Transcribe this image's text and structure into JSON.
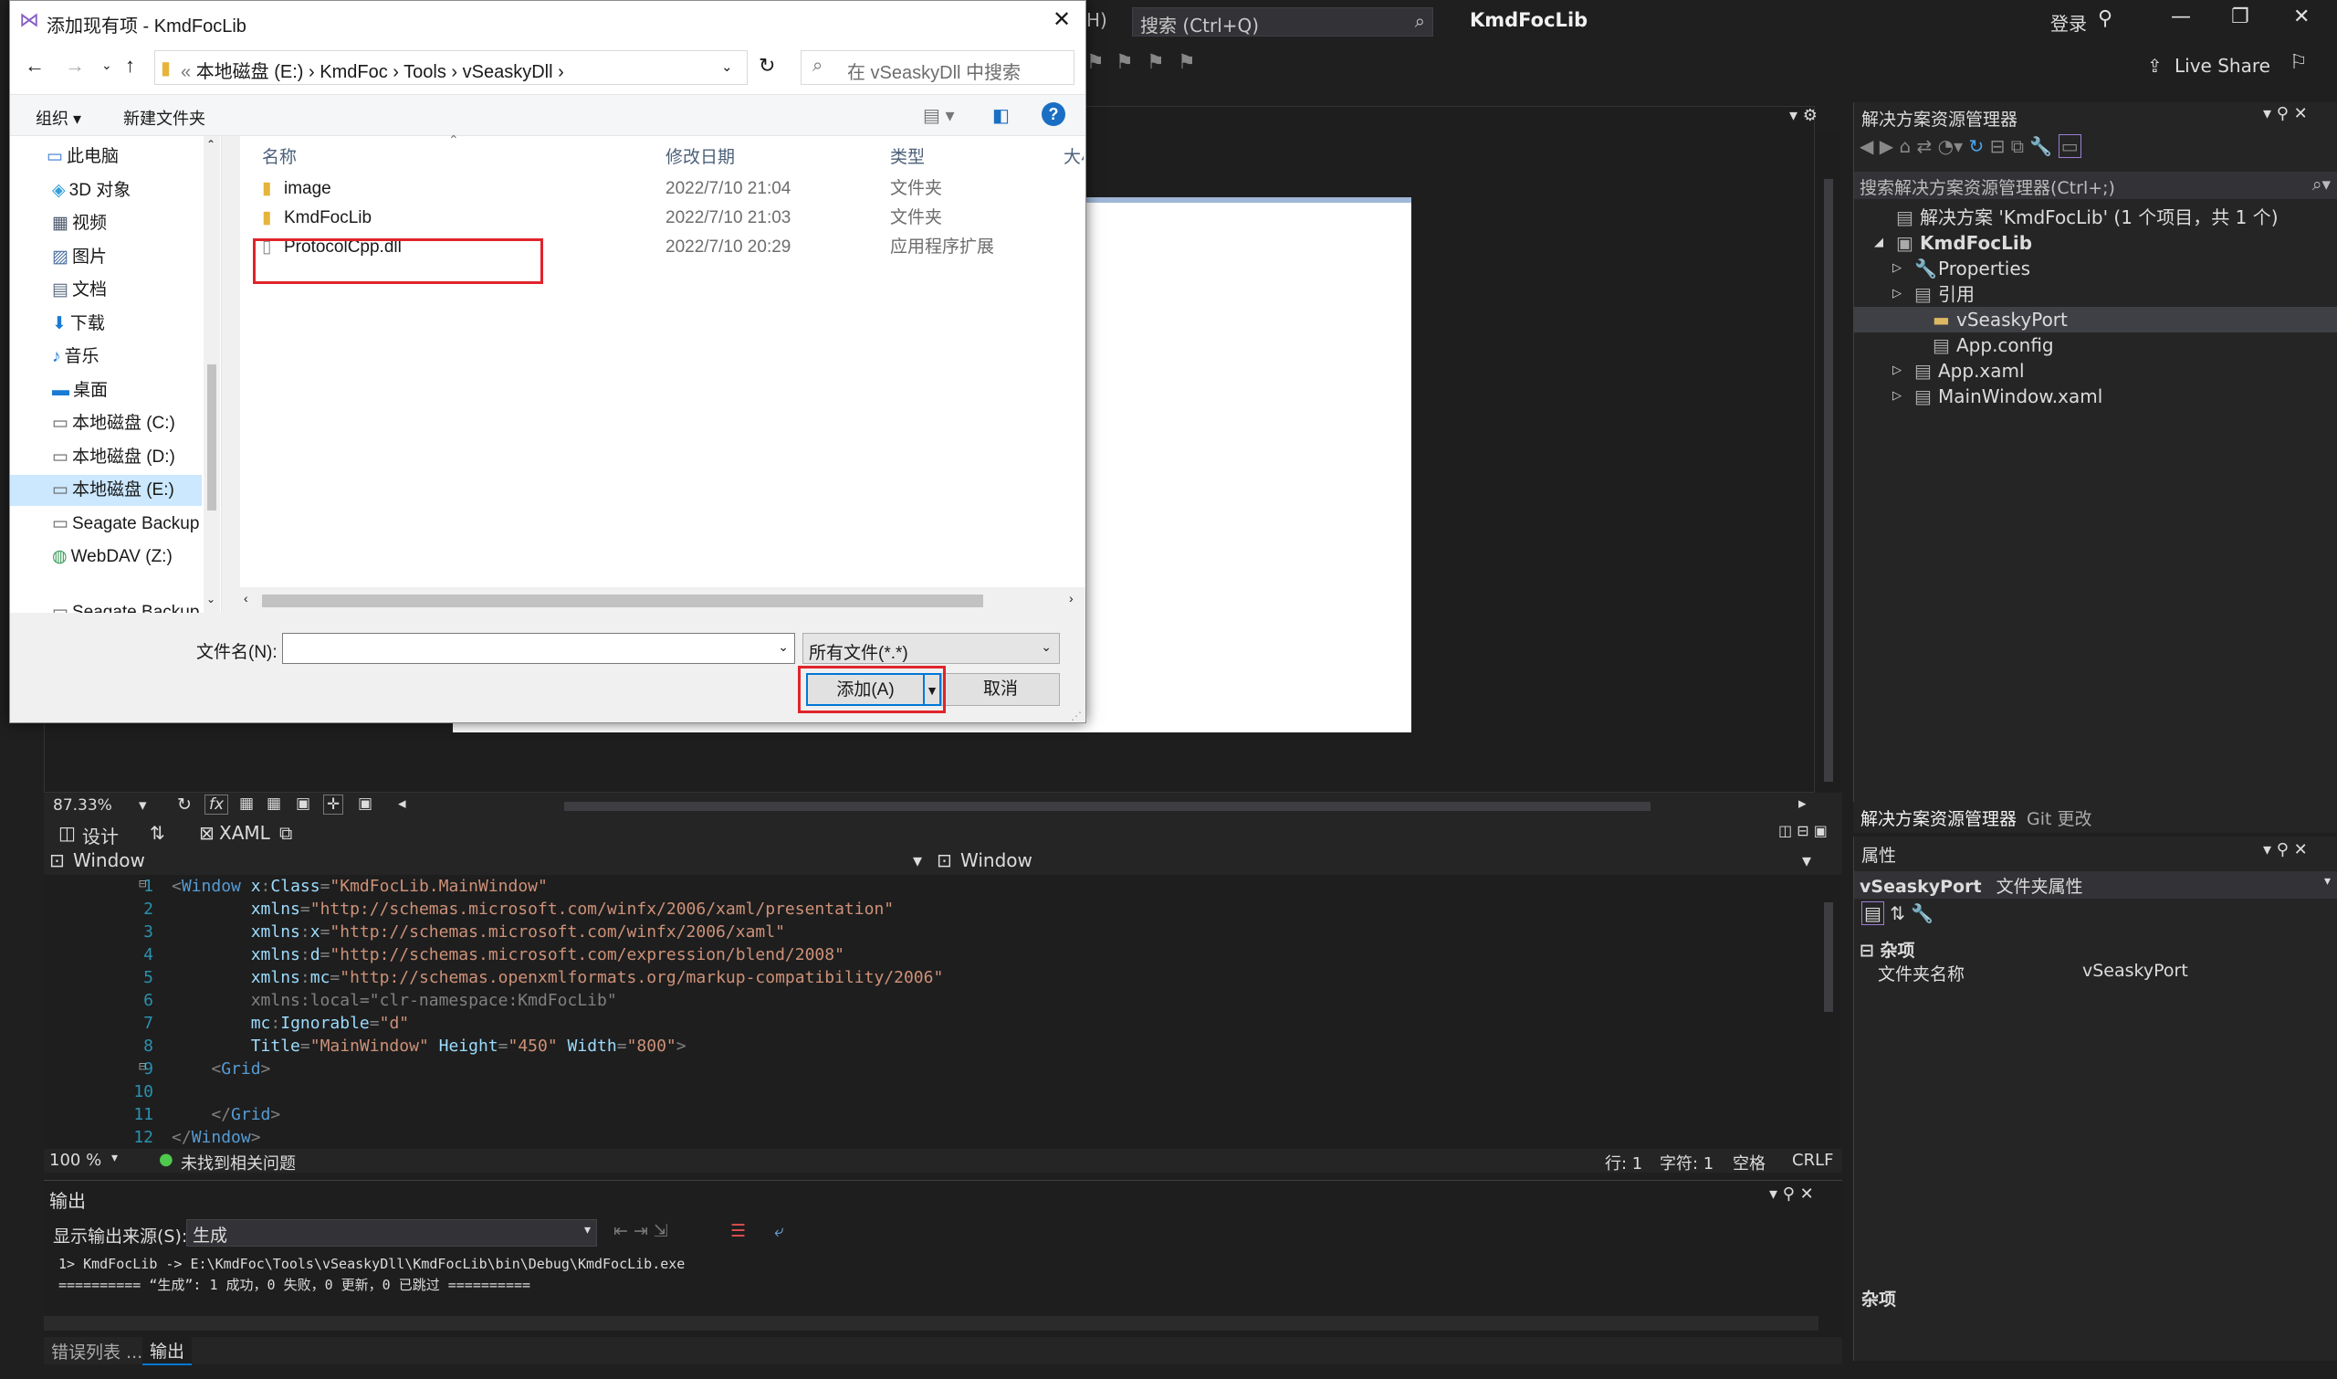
{
  "vs": {
    "menu_fragment": "H)",
    "search_placeholder": "搜索 (Ctrl+Q)",
    "app_title": "KmdFocLib",
    "login": "登录",
    "live_share": "Live Share"
  },
  "designer": {
    "zoom": "87.33%",
    "tab_design": "设计",
    "tab_swap": "⇅",
    "tab_xaml": "XAML"
  },
  "xaml": {
    "left_scope": "Window",
    "right_scope": "Window",
    "zoom": "100 %",
    "issues": "未找到相关问题",
    "row": "行: 1",
    "col": "字符: 1",
    "spaces": "空格",
    "eol": "CRLF",
    "lines": [
      {
        "n": "1",
        "parts": [
          [
            "gray",
            "<"
          ],
          [
            "tag",
            "Window "
          ],
          [
            "attr",
            "x"
          ],
          [
            "gray",
            ":"
          ],
          [
            "attr",
            "Class"
          ],
          [
            "gray",
            "="
          ],
          [
            "val",
            "\"KmdFocLib.MainWindow\""
          ]
        ]
      },
      {
        "n": "2",
        "parts": [
          [
            "gray",
            "        "
          ],
          [
            "attr",
            "xmlns"
          ],
          [
            "gray",
            "="
          ],
          [
            "val",
            "\"http://schemas.microsoft.com/winfx/2006/xaml/presentation\""
          ]
        ]
      },
      {
        "n": "3",
        "parts": [
          [
            "gray",
            "        "
          ],
          [
            "attr",
            "xmlns"
          ],
          [
            "gray",
            ":"
          ],
          [
            "attr",
            "x"
          ],
          [
            "gray",
            "="
          ],
          [
            "val",
            "\"http://schemas.microsoft.com/winfx/2006/xaml\""
          ]
        ]
      },
      {
        "n": "4",
        "parts": [
          [
            "gray",
            "        "
          ],
          [
            "attr",
            "xmlns"
          ],
          [
            "gray",
            ":"
          ],
          [
            "attr",
            "d"
          ],
          [
            "gray",
            "="
          ],
          [
            "val",
            "\"http://schemas.microsoft.com/expression/blend/2008\""
          ]
        ]
      },
      {
        "n": "5",
        "parts": [
          [
            "gray",
            "        "
          ],
          [
            "attr",
            "xmlns"
          ],
          [
            "gray",
            ":"
          ],
          [
            "attr",
            "mc"
          ],
          [
            "gray",
            "="
          ],
          [
            "val",
            "\"http://schemas.openxmlformats.org/markup-compatibility/2006\""
          ]
        ]
      },
      {
        "n": "6",
        "parts": [
          [
            "gray",
            "        xmlns:local=\"clr-namespace:KmdFocLib\""
          ]
        ]
      },
      {
        "n": "7",
        "parts": [
          [
            "gray",
            "        "
          ],
          [
            "attr",
            "mc"
          ],
          [
            "gray",
            ":"
          ],
          [
            "attr",
            "Ignorable"
          ],
          [
            "gray",
            "="
          ],
          [
            "val",
            "\"d\""
          ]
        ]
      },
      {
        "n": "8",
        "parts": [
          [
            "gray",
            "        "
          ],
          [
            "attr",
            "Title"
          ],
          [
            "gray",
            "="
          ],
          [
            "val",
            "\"MainWindow\" "
          ],
          [
            "attr",
            "Height"
          ],
          [
            "gray",
            "="
          ],
          [
            "val",
            "\"450\" "
          ],
          [
            "attr",
            "Width"
          ],
          [
            "gray",
            "="
          ],
          [
            "val",
            "\"800\""
          ],
          [
            "gray",
            ">"
          ]
        ]
      },
      {
        "n": "9",
        "parts": [
          [
            "gray",
            "    <"
          ],
          [
            "tag",
            "Grid"
          ],
          [
            "gray",
            ">"
          ]
        ]
      },
      {
        "n": "10",
        "parts": [
          [
            "gray",
            ""
          ]
        ]
      },
      {
        "n": "11",
        "parts": [
          [
            "gray",
            "    </"
          ],
          [
            "tag",
            "Grid"
          ],
          [
            "gray",
            ">"
          ]
        ]
      },
      {
        "n": "12",
        "parts": [
          [
            "gray",
            "</"
          ],
          [
            "tag",
            "Window"
          ],
          [
            "gray",
            ">"
          ]
        ]
      }
    ]
  },
  "output": {
    "title": "输出",
    "source_label": "显示输出来源(S):",
    "source_value": "生成",
    "line1": "1>  KmdFocLib -> E:\\KmdFoc\\Tools\\vSeaskyDll\\KmdFocLib\\bin\\Debug\\KmdFocLib.exe",
    "line2": "========== “生成”: 1 成功，0 失败，0 更新，0 已跳过 ==========",
    "tab_errors": "错误列表 ...",
    "tab_output": "输出"
  },
  "solution": {
    "title": "解决方案资源管理器",
    "search_placeholder": "搜索解决方案资源管理器(Ctrl+;)",
    "items": [
      {
        "label": "解决方案 'KmdFocLib' (1 个项目，共 1 个)",
        "icon": "solution-icon"
      },
      {
        "label": "KmdFocLib",
        "icon": "csharp-project-icon"
      },
      {
        "label": "Properties",
        "icon": "wrench-icon"
      },
      {
        "label": "引用",
        "icon": "references-icon"
      },
      {
        "label": "vSeaskyPort",
        "icon": "folder-icon"
      },
      {
        "label": "App.config",
        "icon": "config-file-icon"
      },
      {
        "label": "App.xaml",
        "icon": "xaml-file-icon"
      },
      {
        "label": "MainWindow.xaml",
        "icon": "xaml-file-icon"
      }
    ],
    "tab_solution": "解决方案资源管理器",
    "tab_git": "Git 更改"
  },
  "properties": {
    "title": "属性",
    "object_name": "vSeaskyPort",
    "object_type": "文件夹属性",
    "category": "杂项",
    "prop_name": "文件夹名称",
    "prop_value": "vSeaskyPort",
    "desc_title": "杂项"
  },
  "dialog": {
    "title": "添加现有项 - KmdFocLib",
    "breadcrumb": [
      "«",
      "本地磁盘 (E:)",
      "KmdFoc",
      "Tools",
      "vSeaskyDll"
    ],
    "search_placeholder": "在 vSeaskyDll 中搜索",
    "organize": "组织",
    "new_folder": "新建文件夹",
    "nav": [
      {
        "label": "此电脑",
        "icon": "computer-icon"
      },
      {
        "label": "3D 对象",
        "icon": "3d-objects-icon"
      },
      {
        "label": "视频",
        "icon": "video-icon"
      },
      {
        "label": "图片",
        "icon": "pictures-icon"
      },
      {
        "label": "文档",
        "icon": "documents-icon"
      },
      {
        "label": "下载",
        "icon": "download-icon"
      },
      {
        "label": "音乐",
        "icon": "music-icon"
      },
      {
        "label": "桌面",
        "icon": "desktop-icon"
      },
      {
        "label": "本地磁盘 (C:)",
        "icon": "drive-icon"
      },
      {
        "label": "本地磁盘 (D:)",
        "icon": "drive-icon"
      },
      {
        "label": "本地磁盘 (E:)",
        "icon": "drive-icon"
      },
      {
        "label": "Seagate Backup",
        "icon": "drive-icon"
      },
      {
        "label": "WebDAV (Z:)",
        "icon": "network-drive-icon"
      },
      {
        "label": "Seagate Backup",
        "icon": "drive-icon"
      }
    ],
    "columns": [
      "名称",
      "修改日期",
      "类型",
      "大小"
    ],
    "files": [
      {
        "name": "image",
        "date": "2022/7/10 21:04",
        "type": "文件夹",
        "icon": "folder-icon"
      },
      {
        "name": "KmdFocLib",
        "date": "2022/7/10 21:03",
        "type": "文件夹",
        "icon": "folder-icon"
      },
      {
        "name": "ProtocolCpp.dll",
        "date": "2022/7/10 20:29",
        "type": "应用程序扩展",
        "icon": "dll-file-icon"
      }
    ],
    "filename_label": "文件名(N):",
    "filename_value": "",
    "filter": "所有文件(*.*)",
    "add_button": "添加(A)",
    "cancel_button": "取消"
  },
  "colors": {
    "vs_bg": "#1f1f1f",
    "highlight_red": "#e0242c",
    "accent_blue": "#0078d4"
  }
}
